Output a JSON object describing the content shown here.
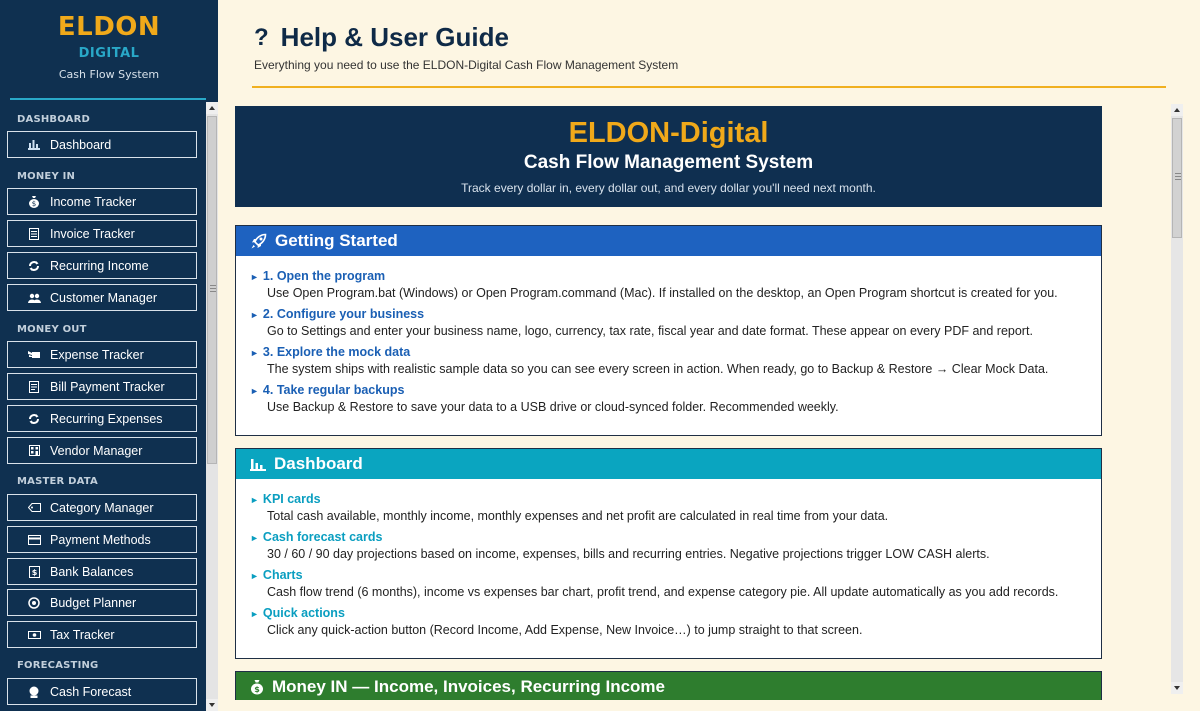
{
  "sidebar": {
    "brand": "ELDON",
    "brand_sub": "DIGITAL",
    "tagline": "Cash Flow System",
    "sections": [
      {
        "label": "DASHBOARD",
        "items": [
          {
            "label": "Dashboard",
            "icon": "bar-chart-icon"
          }
        ]
      },
      {
        "label": "MONEY IN",
        "items": [
          {
            "label": "Income Tracker",
            "icon": "money-bag-icon"
          },
          {
            "label": "Invoice Tracker",
            "icon": "receipt-icon"
          },
          {
            "label": "Recurring Income",
            "icon": "refresh-icon"
          },
          {
            "label": "Customer Manager",
            "icon": "users-icon"
          }
        ]
      },
      {
        "label": "MONEY OUT",
        "items": [
          {
            "label": "Expense Tracker",
            "icon": "money-wings-icon"
          },
          {
            "label": "Bill Payment Tracker",
            "icon": "bill-icon"
          },
          {
            "label": "Recurring Expenses",
            "icon": "refresh-icon"
          },
          {
            "label": "Vendor Manager",
            "icon": "building-icon"
          }
        ]
      },
      {
        "label": "MASTER DATA",
        "items": [
          {
            "label": "Category Manager",
            "icon": "tag-icon"
          },
          {
            "label": "Payment Methods",
            "icon": "credit-card-icon"
          },
          {
            "label": "Bank Balances",
            "icon": "bank-icon"
          },
          {
            "label": "Budget Planner",
            "icon": "target-icon"
          },
          {
            "label": "Tax Tracker",
            "icon": "tax-icon"
          }
        ]
      },
      {
        "label": "FORECASTING",
        "items": [
          {
            "label": "Cash Forecast",
            "icon": "crystal-ball-icon"
          }
        ]
      }
    ]
  },
  "header": {
    "title": "Help & User Guide",
    "subtitle": "Everything you need to use the ELDON-Digital Cash Flow Management System"
  },
  "hero": {
    "title": "ELDON-Digital",
    "subtitle": "Cash Flow Management System",
    "tagline": "Track every dollar in, every dollar out, and every dollar you'll need next month."
  },
  "sections": [
    {
      "title": "Getting Started",
      "icon": "rocket-icon",
      "color": "#1e62c0",
      "title_color": "#1a5fb4",
      "entries": [
        {
          "title": "1. Open the program",
          "text": "Use Open Program.bat (Windows) or Open Program.command (Mac). If installed on the desktop, an Open Program shortcut is created for you."
        },
        {
          "title": "2. Configure your business",
          "text": "Go to Settings and enter your business name, logo, currency, tax rate, fiscal year and date format. These appear on every PDF and report."
        },
        {
          "title": "3. Explore the mock data",
          "text": "The system ships with realistic sample data so you can see every screen in action. When ready, go to Backup & Restore → Clear Mock Data."
        },
        {
          "title": "4. Take regular backups",
          "text": "Use Backup & Restore to save your data to a USB drive or cloud-synced folder. Recommended weekly."
        }
      ]
    },
    {
      "title": "Dashboard",
      "icon": "bar-chart-icon",
      "color": "#0aa5c0",
      "title_color": "#0a9ec0",
      "entries": [
        {
          "title": "KPI cards",
          "text": "Total cash available, monthly income, monthly expenses and net profit are calculated in real time from your data."
        },
        {
          "title": "Cash forecast cards",
          "text": "30 / 60 / 90 day projections based on income, expenses, bills and recurring entries. Negative projections trigger LOW CASH alerts."
        },
        {
          "title": "Charts",
          "text": "Cash flow trend (6 months), income vs expenses bar chart, profit trend, and expense category pie. All update automatically as you add records."
        },
        {
          "title": "Quick actions",
          "text": "Click any quick-action button (Record Income, Add Expense, New Invoice…) to jump straight to that screen."
        }
      ]
    },
    {
      "title": "Money IN — Income, Invoices, Recurring Income",
      "icon": "money-bag-icon",
      "color": "#2e7d2e"
    }
  ]
}
